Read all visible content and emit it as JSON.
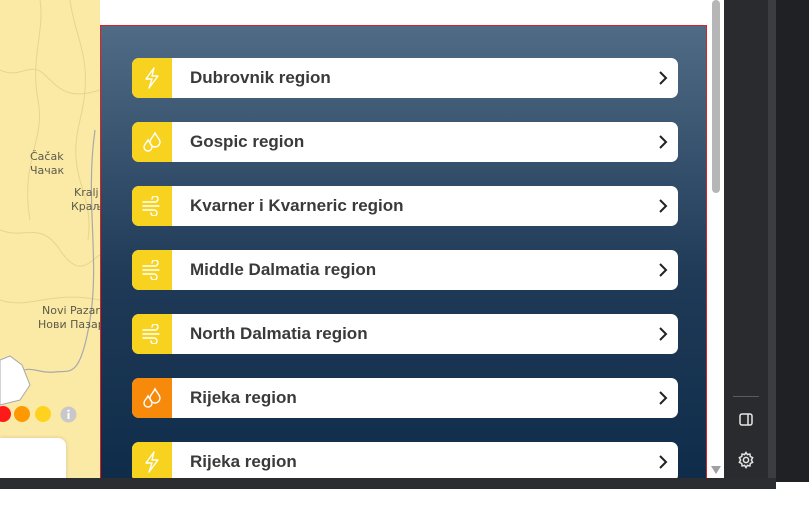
{
  "map": {
    "labels": [
      {
        "text": "Čačak"
      },
      {
        "text": "Чачак"
      },
      {
        "text": "Kralj"
      },
      {
        "text": "Краљ"
      },
      {
        "text": "Novi Pazar"
      },
      {
        "text": "Нови Пазар"
      }
    ],
    "legend_colors": [
      "#ff1a1a",
      "#ff9900",
      "#ffd21f"
    ],
    "info_icon": "info-icon"
  },
  "colors": {
    "yellow": "#f7d21e",
    "orange": "#f7890b",
    "panel_border": "#e02020"
  },
  "regions": [
    {
      "label": "Dubrovnik region",
      "icon": "lightning-icon",
      "color": "yellow"
    },
    {
      "label": "Gospic region",
      "icon": "drops-icon",
      "color": "yellow"
    },
    {
      "label": "Kvarner i Kvarneric region",
      "icon": "wind-icon",
      "color": "yellow"
    },
    {
      "label": "Middle Dalmatia region",
      "icon": "wind-icon",
      "color": "yellow"
    },
    {
      "label": "North Dalmatia region",
      "icon": "wind-icon",
      "color": "yellow"
    },
    {
      "label": "Rijeka region",
      "icon": "drops-icon",
      "color": "orange"
    },
    {
      "label": "Rijeka region",
      "icon": "lightning-icon",
      "color": "yellow"
    }
  ],
  "sidebar": {
    "buttons": [
      "side-panel-icon",
      "gear-icon"
    ]
  }
}
